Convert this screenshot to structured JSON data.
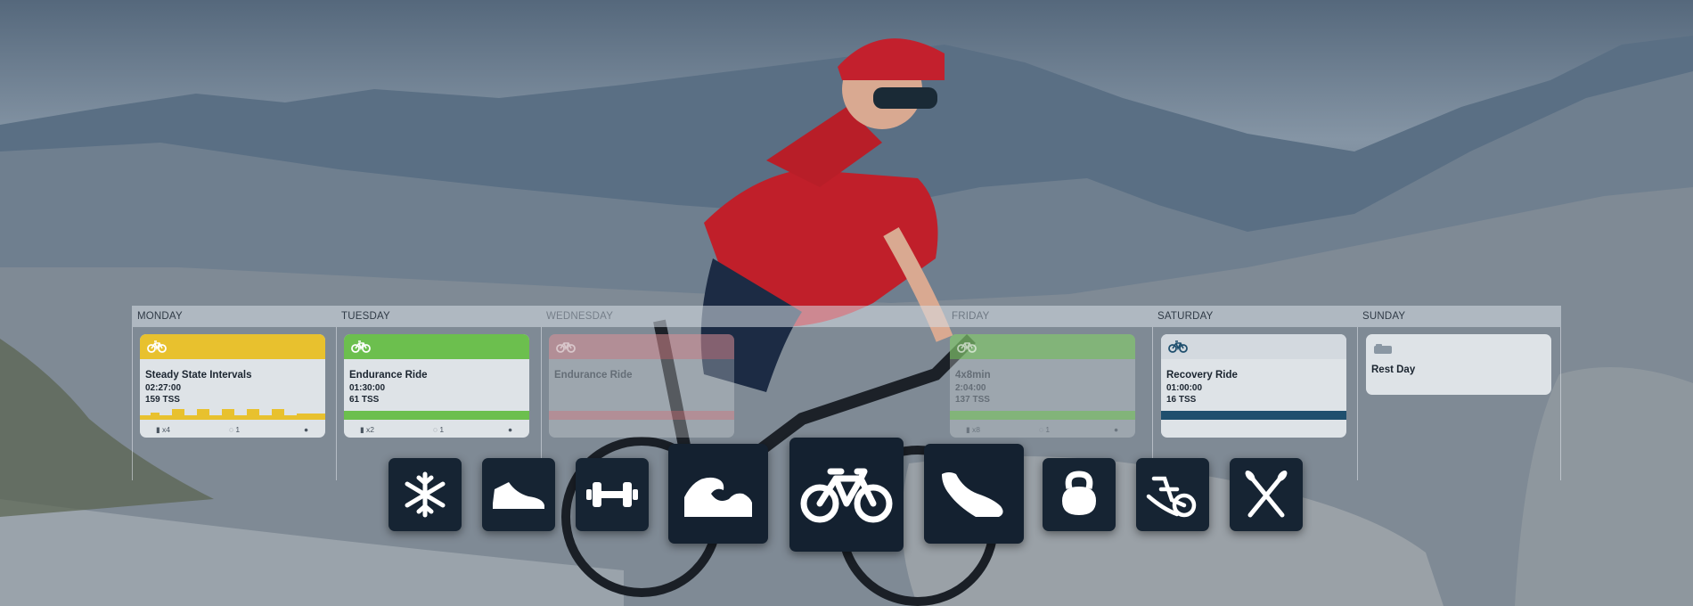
{
  "days": [
    {
      "name": "MONDAY"
    },
    {
      "name": "TUESDAY"
    },
    {
      "name": "WEDNESDAY"
    },
    {
      "name": "FRIDAY"
    },
    {
      "name": "SATURDAY"
    },
    {
      "name": "SUNDAY"
    }
  ],
  "workouts": [
    {
      "title": "Steady State Intervals",
      "duration": "02:27:00",
      "tss": "159 TSS",
      "icon": "bike-icon",
      "color": "#e8c12e",
      "faded": false,
      "footer": {
        "reps": "x4",
        "comments_count": "1"
      }
    },
    {
      "title": "Endurance Ride",
      "duration": "01:30:00",
      "tss": "61 TSS",
      "icon": "bike-icon",
      "color": "#6cbf4e",
      "faded": false,
      "footer": {
        "reps": "x2",
        "comments_count": "1"
      }
    },
    {
      "title": "Endurance Ride",
      "icon": "bike-icon",
      "color": "#d9606a",
      "faded": true
    },
    {
      "title": "4x8min",
      "duration": "2:04:00",
      "tss": "137 TSS",
      "icon": "bike-icon",
      "color": "#6cbf4e",
      "faded": true,
      "footer": {
        "reps": "x8",
        "comments_count": "1"
      }
    },
    {
      "title": "Recovery Ride",
      "duration": "01:00:00",
      "tss": "16 TSS",
      "icon": "bike-icon",
      "color": "#1f4f6e",
      "faded": false
    },
    {
      "title": "Rest Day",
      "icon": "bed-icon",
      "color": "#d3d9df",
      "faded": false
    }
  ],
  "sports": [
    "snowflake-icon",
    "shoe-icon",
    "dumbbell-icon",
    "swim-wave-icon",
    "bike-icon",
    "running-shoe-icon",
    "kettlebell-icon",
    "mountain-bike-icon",
    "rowing-oars-icon"
  ],
  "colors": {
    "tile": "#162433",
    "accent_yellow": "#e8c12e",
    "accent_green": "#6cbf4e",
    "accent_navy": "#1f4f6e"
  }
}
